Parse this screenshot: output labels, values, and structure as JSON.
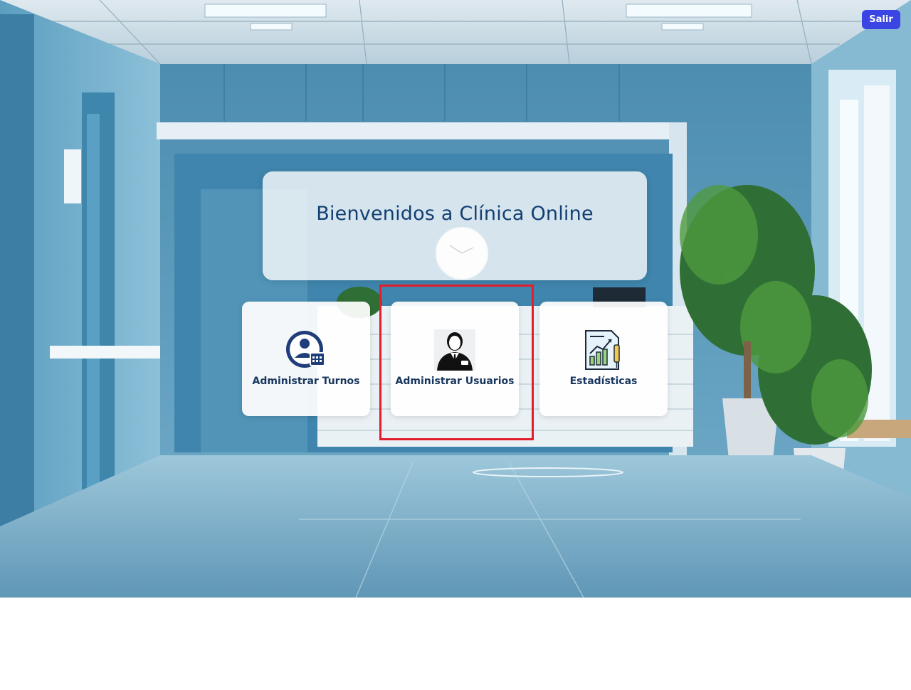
{
  "header": {
    "logout_label": "Salir"
  },
  "welcome": {
    "title": "Bienvenidos a Clínica Online"
  },
  "menu": {
    "items": [
      {
        "label": "Administrar Turnos",
        "icon": "appointments-icon"
      },
      {
        "label": "Administrar Usuarios",
        "icon": "user-admin-icon"
      },
      {
        "label": "Estadísticas",
        "icon": "statistics-icon"
      }
    ]
  },
  "colors": {
    "accent": "#3b45e3",
    "title": "#123f72",
    "highlight": "#e41d2b"
  }
}
